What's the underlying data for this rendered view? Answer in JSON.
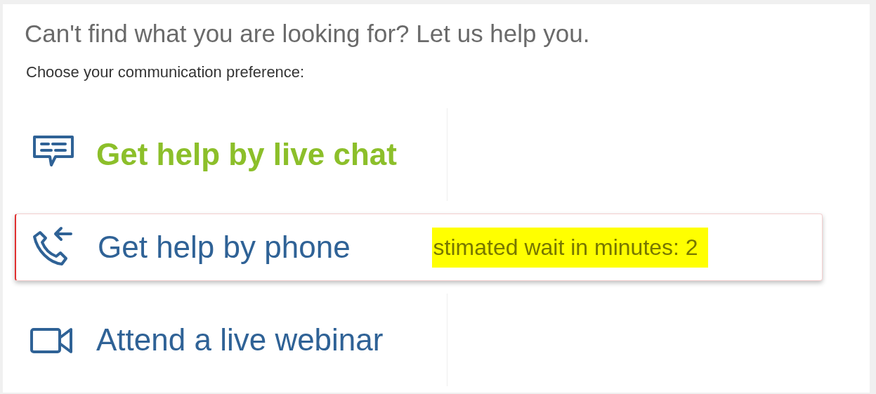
{
  "heading": "Can't find what you are looking for? Let us help you.",
  "prompt": "Choose your communication preference:",
  "options": [
    {
      "kind": "chat",
      "label": "Get help by live chat",
      "selected": true,
      "expanded": false
    },
    {
      "kind": "phone",
      "label": "Get help by phone",
      "selected": false,
      "expanded": true,
      "wait": "stimated wait in minutes: 2"
    },
    {
      "kind": "video",
      "label": "Attend a live webinar",
      "selected": false,
      "expanded": false
    }
  ]
}
